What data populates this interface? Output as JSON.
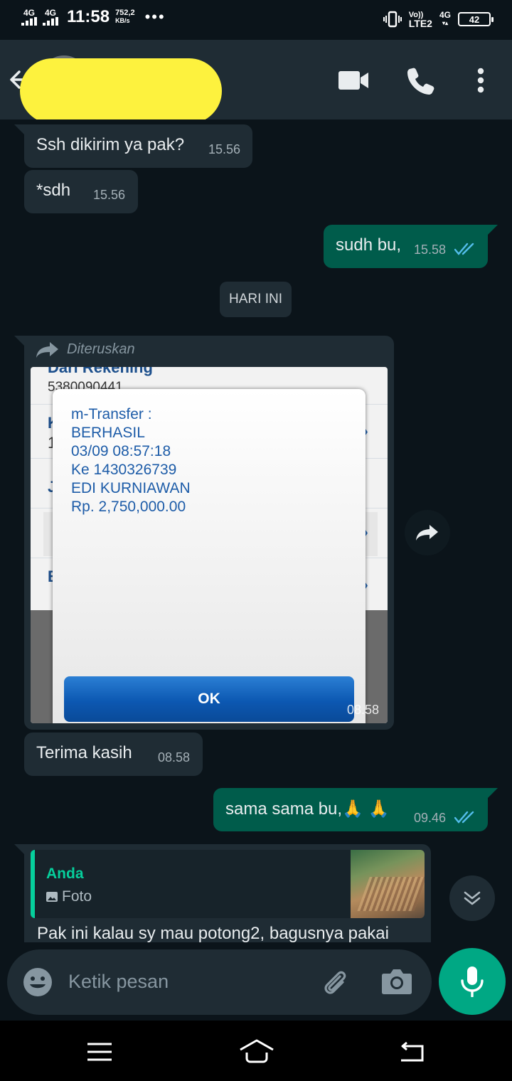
{
  "status_bar": {
    "network_1": "4G",
    "network_2": "4G",
    "time": "11:58",
    "speed_value": "752,2",
    "speed_unit": "KB/s",
    "more": "•••",
    "volte_top": "Vo))",
    "volte_bottom": "LTE2",
    "data_network": "4G",
    "data_arrows": "▾▴",
    "battery": "42"
  },
  "header": {
    "contact_name_redacted": true
  },
  "messages": [
    {
      "direction": "in",
      "text": "Ssh dikirim ya pak?",
      "time": "15.56"
    },
    {
      "direction": "in",
      "text": "*sdh",
      "time": "15.56"
    },
    {
      "direction": "out",
      "text": "sudh bu,",
      "time": "15.58",
      "status": "read"
    },
    {
      "direction": "in",
      "text": "Terima kasih",
      "time": "08.58"
    },
    {
      "direction": "out",
      "text": "sama sama bu,🙏 🙏",
      "time": "09.46",
      "status": "read"
    }
  ],
  "day_divider": "HARI INI",
  "forwarded": {
    "label": "Diteruskan",
    "time": "08.58",
    "screenshot": {
      "bg_fragment_1": "Dari Rekening",
      "bg_fragment_2": "5380090441",
      "bg_fragment_3": "K",
      "bg_fragment_4": "1",
      "bg_fragment_5": "J",
      "bg_fragment_6": "B",
      "dialog_lines": [
        "m-Transfer :",
        "BERHASIL",
        "03/09 08:57:18",
        "Ke 1430326739",
        "EDI KURNIAWAN",
        "Rp. 2,750,000.00"
      ],
      "ok_label": "OK"
    }
  },
  "reply": {
    "quoted_author": "Anda",
    "quoted_type": "Foto",
    "text": "Pak ini kalau sy mau potong2, bagusnya pakai"
  },
  "composer": {
    "placeholder": "Ketik pesan"
  },
  "colors": {
    "background": "#0b141a",
    "incoming": "#1f2c34",
    "outgoing": "#005c4b",
    "accent": "#00a884",
    "read_ticks": "#53bdeb",
    "redaction": "#fdf23e"
  }
}
